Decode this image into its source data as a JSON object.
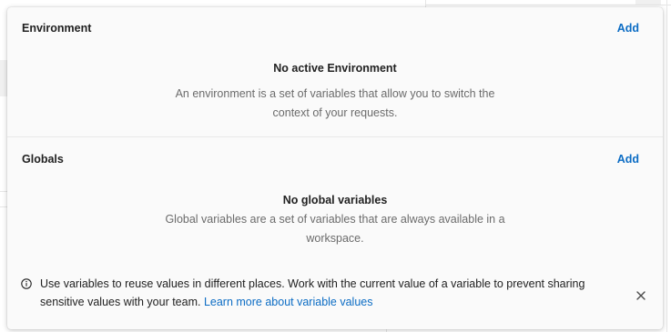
{
  "environment": {
    "title": "Environment",
    "add_label": "Add",
    "empty_title": "No active Environment",
    "empty_description": "An environment is a set of variables that allow you to switch the context of your requests."
  },
  "globals": {
    "title": "Globals",
    "add_label": "Add",
    "empty_title": "No global variables",
    "empty_description": "Global variables are a set of variables that are always available in a workspace."
  },
  "info_banner": {
    "icon": "info-icon",
    "text": "Use variables to reuse values in different places. Work with the current value of a variable to prevent sharing sensitive values with your team.",
    "link_label": "Learn more about variable values",
    "close_icon": "close-icon"
  },
  "colors": {
    "accent_link": "#0b6cc4",
    "panel_bg": "#fafafa",
    "muted_text": "#6b6b6b"
  }
}
